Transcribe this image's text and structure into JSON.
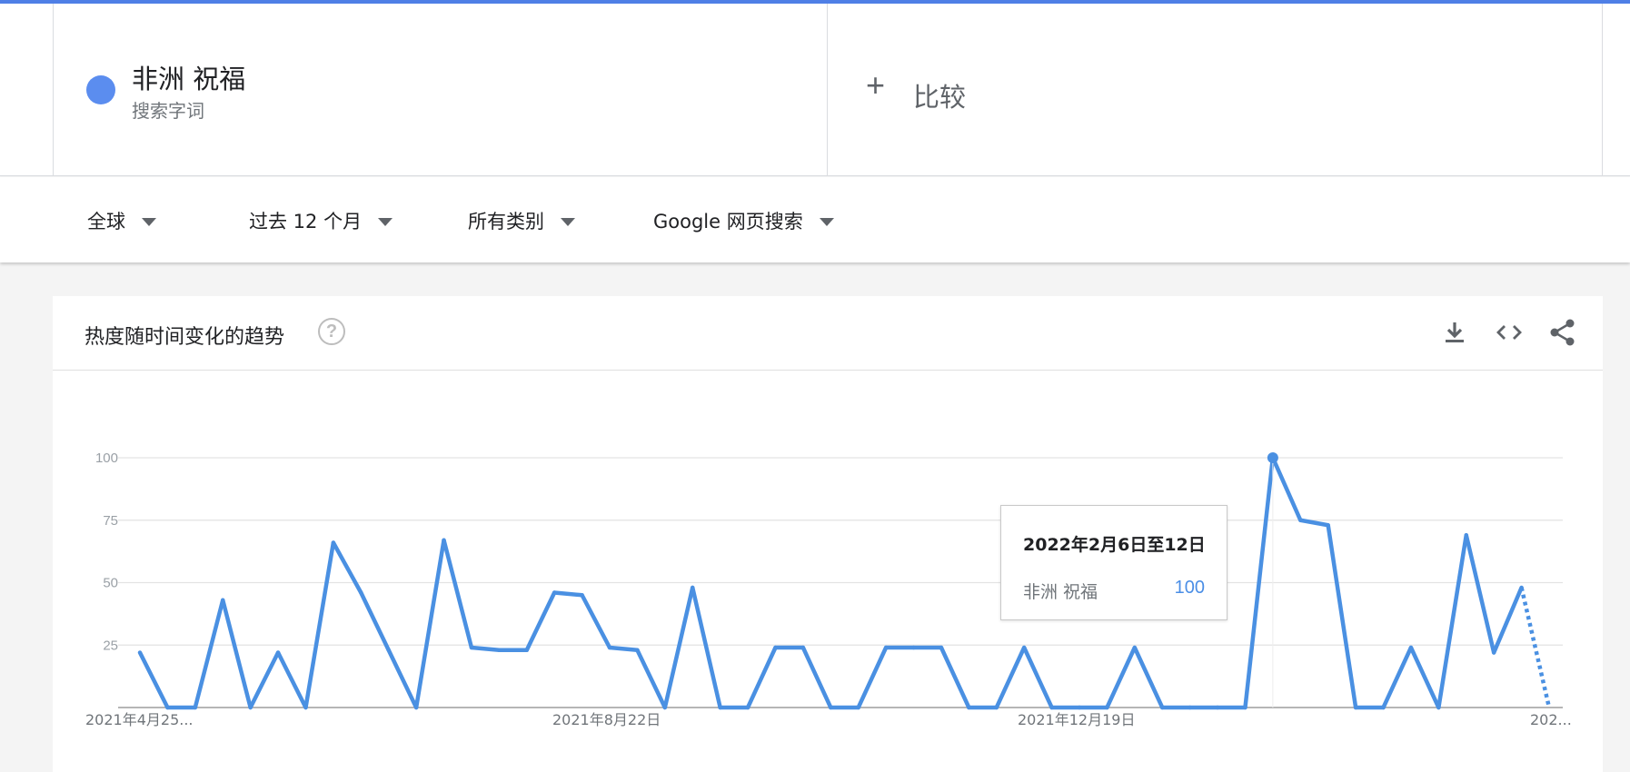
{
  "header": {
    "term": {
      "name": "非洲 祝福",
      "type": "搜索字词",
      "color": "#5b8def"
    },
    "compare": {
      "icon": "plus-icon",
      "label": "比较"
    }
  },
  "filters": [
    {
      "label": "全球"
    },
    {
      "label": "过去 12 个月"
    },
    {
      "label": "所有类别"
    },
    {
      "label": "Google 网页搜索"
    }
  ],
  "panel": {
    "title": "热度随时间变化的趋势",
    "help": "?",
    "tools": [
      "download-icon",
      "embed-code-icon",
      "share-icon"
    ]
  },
  "tooltip": {
    "date": "2022年2月6日至12日",
    "term": "非洲 祝福",
    "value": "100"
  },
  "chart_data": {
    "type": "line",
    "series": [
      {
        "name": "非洲 祝福",
        "color": "#4a90e2",
        "values": [
          22,
          0,
          0,
          43,
          0,
          22,
          0,
          66,
          46,
          23,
          0,
          67,
          24,
          23,
          23,
          46,
          45,
          24,
          23,
          0,
          48,
          0,
          0,
          24,
          24,
          0,
          0,
          24,
          24,
          24,
          0,
          0,
          24,
          0,
          0,
          0,
          24,
          0,
          0,
          0,
          0,
          100,
          75,
          73,
          0,
          0,
          24,
          0,
          69,
          22,
          48,
          0
        ],
        "partial_last_segment": true
      }
    ],
    "x_labels": [
      "2021年4月25...",
      "2021年8月22日",
      "2021年12月19日",
      "202..."
    ],
    "y_ticks": [
      100,
      75,
      50,
      25
    ],
    "ylim": [
      0,
      100
    ],
    "highlight_index": 41,
    "grid": true
  }
}
